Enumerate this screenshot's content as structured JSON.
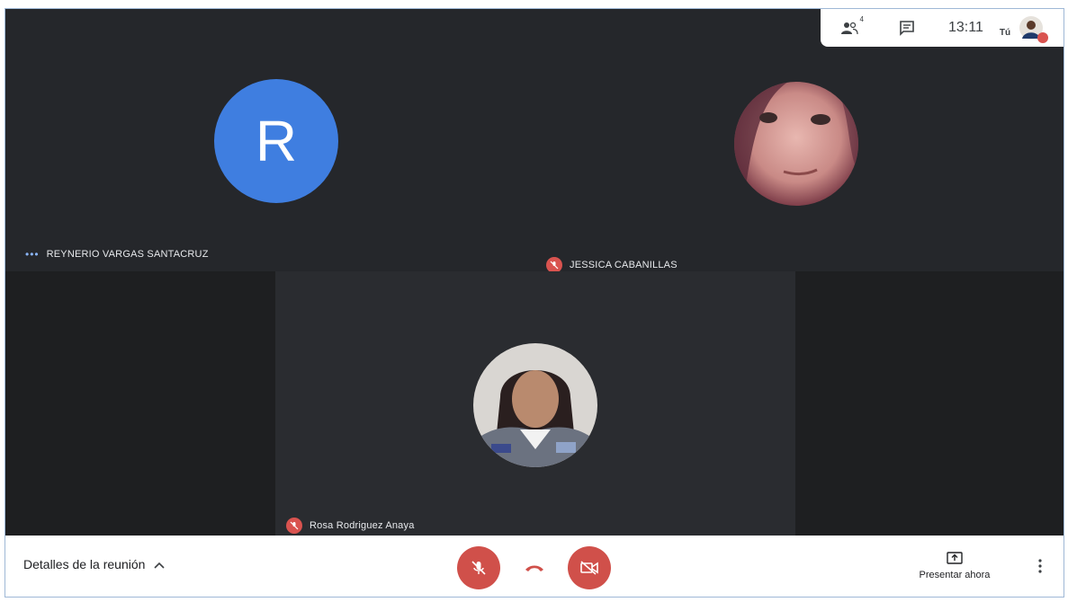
{
  "header": {
    "participant_count": "4",
    "time": "13:11",
    "you_label": "Tú"
  },
  "participants": [
    {
      "name": "REYNERIO VARGAS SANTACRUZ",
      "avatar_letter": "R",
      "avatar_color": "#3f7ee0"
    },
    {
      "name": "JESSICA CABANILLAS"
    },
    {
      "name": "Rosa Rodriguez Anaya"
    }
  ],
  "footer": {
    "details_label": "Detalles de la reunión",
    "present_label": "Presentar ahora"
  },
  "icons": {
    "people": "people-icon",
    "chat": "chat-icon",
    "mic_off": "mic-off-icon",
    "hangup": "hang-up-icon",
    "video_off": "video-off-icon",
    "present": "present-screen-icon",
    "more": "more-vert-icon",
    "expand": "chevron-up-icon"
  },
  "colors": {
    "stage_bg": "#202124",
    "control_red": "#d0504a",
    "avatar_blue": "#3f7ee0"
  }
}
